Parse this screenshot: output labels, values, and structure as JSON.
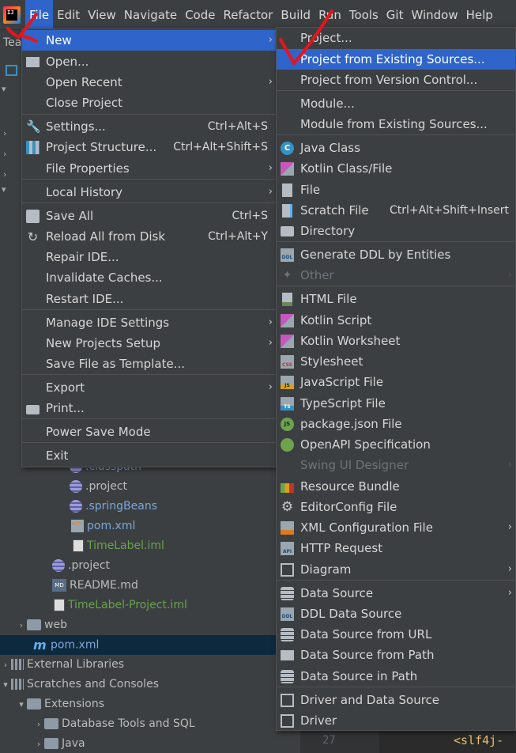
{
  "menubar": {
    "logo_text": "IJ",
    "items": [
      "File",
      "Edit",
      "View",
      "Navigate",
      "Code",
      "Refactor",
      "Build",
      "Run",
      "Tools",
      "Git",
      "Window",
      "Help"
    ],
    "active_item": "File"
  },
  "file_menu": {
    "new": "New",
    "open": "Open...",
    "open_recent": "Open Recent",
    "close_project": "Close Project",
    "settings": "Settings...",
    "settings_shortcut": "Ctrl+Alt+S",
    "project_structure": "Project Structure...",
    "project_structure_shortcut": "Ctrl+Alt+Shift+S",
    "file_properties": "File Properties",
    "local_history": "Local History",
    "save_all": "Save All",
    "save_all_shortcut": "Ctrl+S",
    "reload": "Reload All from Disk",
    "reload_shortcut": "Ctrl+Alt+Y",
    "repair_ide": "Repair IDE...",
    "invalidate_caches": "Invalidate Caches...",
    "restart_ide": "Restart IDE...",
    "manage_ide_settings": "Manage IDE Settings",
    "new_projects_setup": "New Projects Setup",
    "save_file_as_template": "Save File as Template...",
    "export": "Export",
    "print": "Print...",
    "power_save_mode": "Power Save Mode",
    "exit": "Exit"
  },
  "new_menu": {
    "project": "Project...",
    "project_from_existing": "Project from Existing Sources...",
    "project_from_vcs": "Project from Version Control...",
    "module": "Module...",
    "module_from_existing": "Module from Existing Sources...",
    "java_class": "Java Class",
    "kotlin_class": "Kotlin Class/File",
    "file": "File",
    "scratch_file": "Scratch File",
    "scratch_file_shortcut": "Ctrl+Alt+Shift+Insert",
    "directory": "Directory",
    "generate_ddl": "Generate DDL by Entities",
    "other": "Other",
    "html_file": "HTML File",
    "kotlin_script": "Kotlin Script",
    "kotlin_worksheet": "Kotlin Worksheet",
    "stylesheet": "Stylesheet",
    "javascript_file": "JavaScript File",
    "typescript_file": "TypeScript File",
    "package_json": "package.json File",
    "openapi": "OpenAPI Specification",
    "swing_ui_designer": "Swing UI Designer",
    "resource_bundle": "Resource Bundle",
    "editorconfig": "EditorConfig File",
    "xml_config": "XML Configuration File",
    "http_request": "HTTP Request",
    "diagram": "Diagram",
    "data_source": "Data Source",
    "ddl_data_source": "DDL Data Source",
    "data_source_url": "Data Source from URL",
    "data_source_path": "Data Source from Path",
    "data_source_in_path": "Data Source in Path",
    "driver_and_data_source": "Driver and Data Source",
    "driver": "Driver",
    "icon_labels": {
      "java": "C",
      "ddl": "DDL",
      "css": "CSS",
      "js": "JS",
      "ts": "TS",
      "pkg": "JS",
      "api": "API"
    }
  },
  "project_tree": {
    "rows": [
      {
        "label": ".classpath"
      },
      {
        "label": ".project"
      },
      {
        "label": ".springBeans"
      },
      {
        "label": "pom.xml"
      },
      {
        "label": "TimeLabel.iml"
      },
      {
        "label": ".project"
      },
      {
        "label": "README.md"
      },
      {
        "label": "TimeLabel-Project.iml"
      },
      {
        "label": "web"
      },
      {
        "label": "pom.xml"
      },
      {
        "label": "External Libraries"
      },
      {
        "label": "Scratches and Consoles"
      },
      {
        "label": "Extensions"
      },
      {
        "label": "Database Tools and SQL"
      },
      {
        "label": "Java"
      }
    ],
    "md_icon": "MD",
    "m_icon": "m"
  },
  "editor": {
    "line_number": "27",
    "code": "<slf4j-"
  },
  "side_label": "Tea",
  "colors": {
    "menu_bg": "#3c3f41",
    "highlight": "#2f65ca",
    "annotation": "#e8141c"
  }
}
